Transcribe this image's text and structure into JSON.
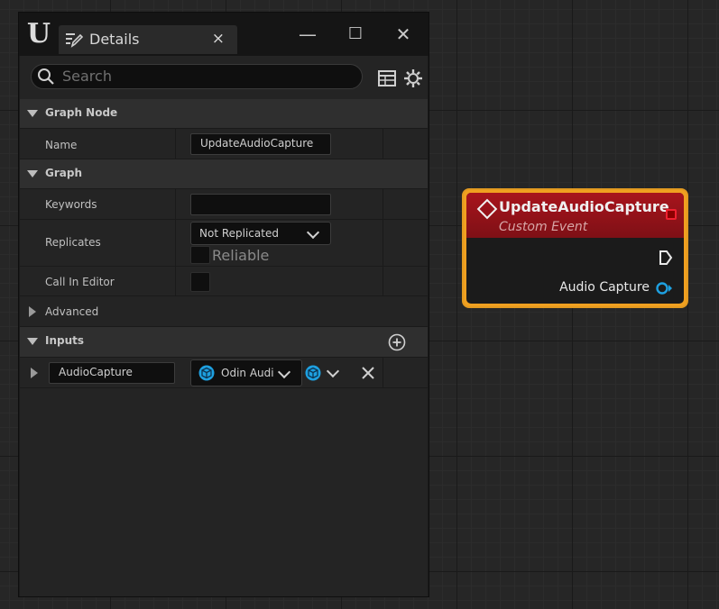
{
  "window": {
    "tab_title": "Details",
    "tab_close": "×",
    "minimize": "—",
    "maximize": "☐",
    "close": "✕"
  },
  "search": {
    "placeholder": "Search"
  },
  "sections": {
    "graph_node": "Graph Node",
    "graph": "Graph",
    "advanced": "Advanced",
    "inputs": "Inputs"
  },
  "properties": {
    "name_label": "Name",
    "name_value": "UpdateAudioCapture",
    "keywords_label": "Keywords",
    "keywords_value": "",
    "replicates_label": "Replicates",
    "replicates_value": "Not Replicated",
    "reliable_label": "Reliable",
    "call_in_editor_label": "Call In Editor"
  },
  "inputs": {
    "param_name": "AudioCapture",
    "param_type": "Odin Audi"
  },
  "node": {
    "title": "UpdateAudioCapture",
    "subtitle": "Custom Event",
    "output_pin": "Audio Capture"
  },
  "colors": {
    "node_border": "#f0a020",
    "node_header": "#a8141c",
    "pin_blue": "#1ea0e0"
  }
}
